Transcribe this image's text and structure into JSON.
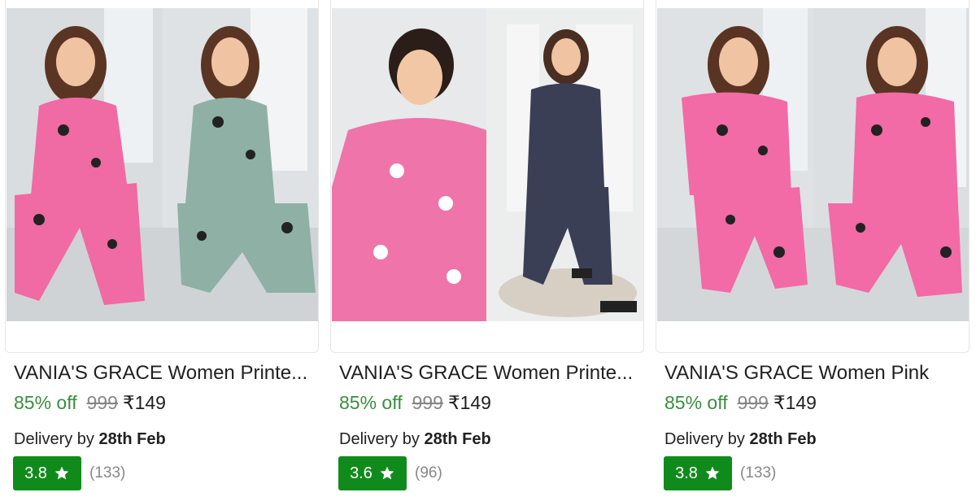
{
  "products": [
    {
      "title": "VANIA'S GRACE Women Printe...",
      "discount": "85% off",
      "mrp": "999",
      "price": "₹149",
      "delivery_prefix": "Delivery by",
      "delivery_date": "28th Feb",
      "rating": "3.8",
      "rating_count": "(133)",
      "outfit_colors": [
        "#f06aa4",
        "#8fb0a4"
      ]
    },
    {
      "title": "VANIA'S GRACE Women Printe...",
      "discount": "85% off",
      "mrp": "999",
      "price": "₹149",
      "delivery_prefix": "Delivery by",
      "delivery_date": "28th Feb",
      "rating": "3.6",
      "rating_count": "(96)",
      "outfit_colors": [
        "#ee74a9",
        "#3a3f55"
      ]
    },
    {
      "title": "VANIA'S GRACE Women Pink",
      "discount": "85% off",
      "mrp": "999",
      "price": "₹149",
      "delivery_prefix": "Delivery by",
      "delivery_date": "28th Feb",
      "rating": "3.8",
      "rating_count": "(133)",
      "outfit_colors": [
        "#f26aa6",
        "#f26aa6"
      ]
    }
  ],
  "colors": {
    "discount": "#388e3c",
    "rating_badge": "#108b1b",
    "muted": "#878787"
  },
  "icons": {
    "rating": "star-icon"
  }
}
